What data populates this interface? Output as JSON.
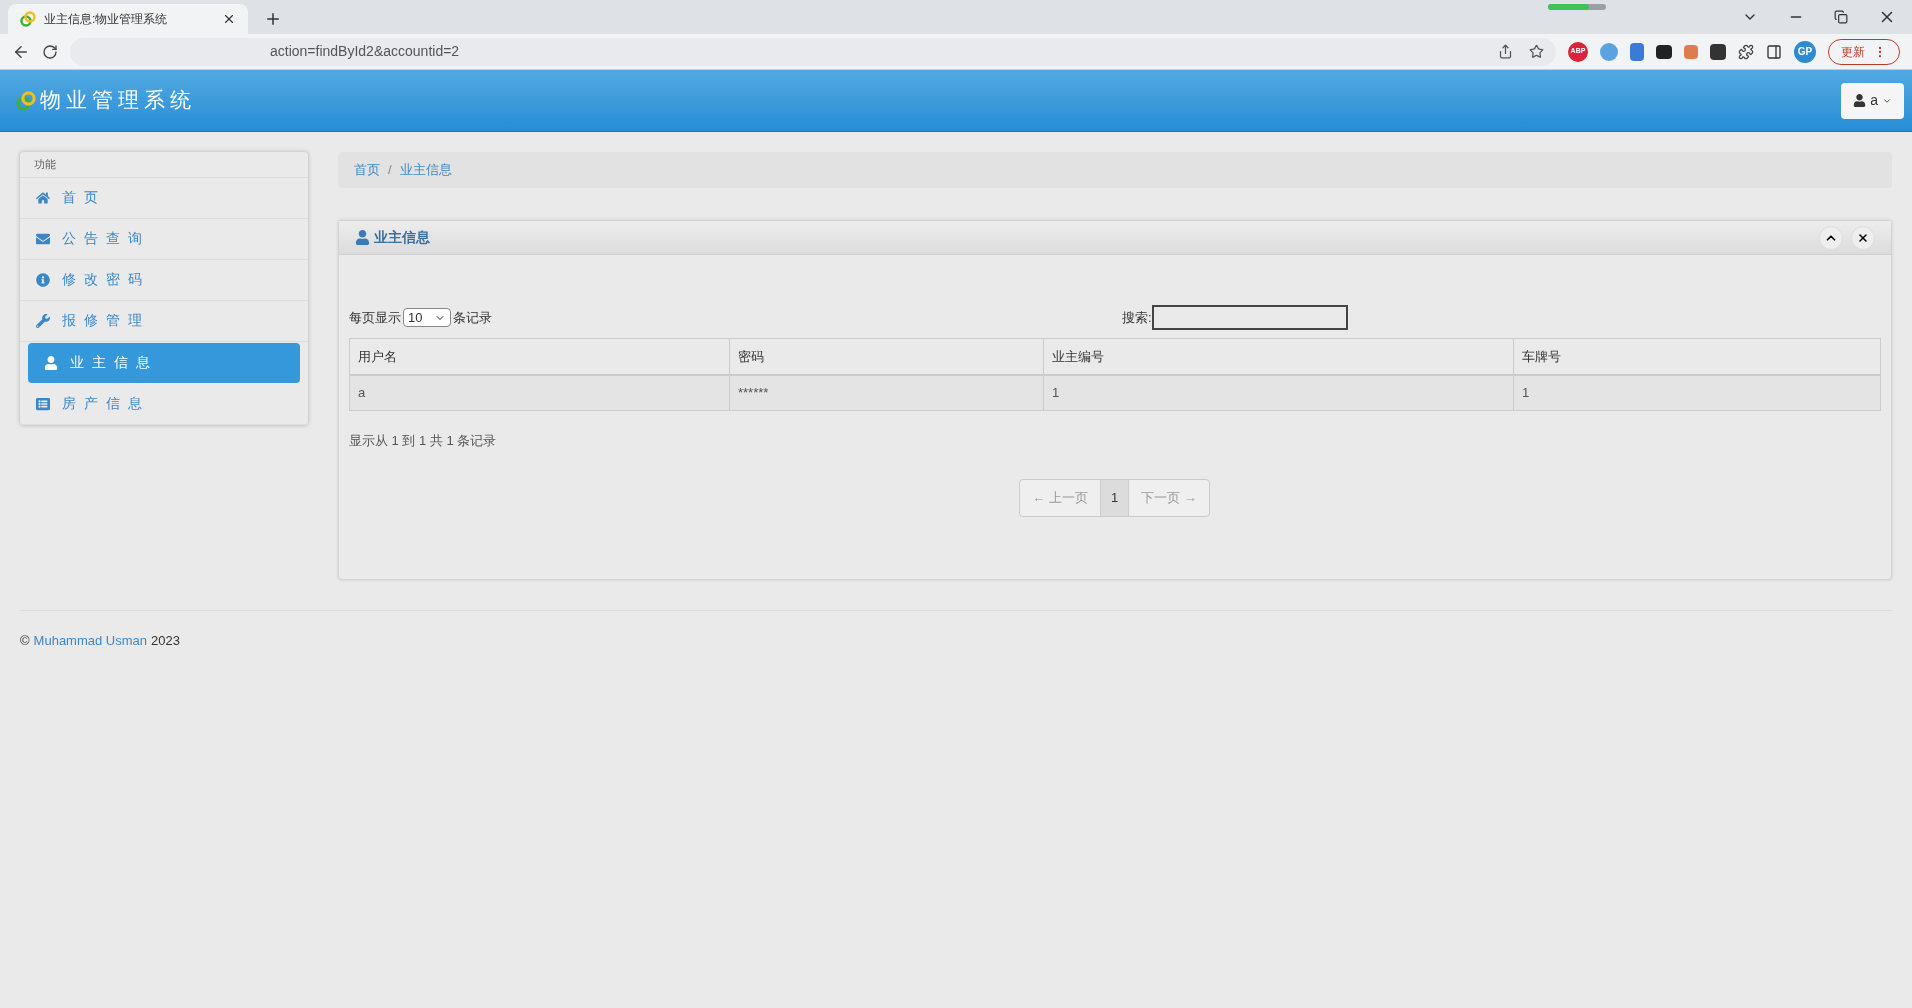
{
  "browser": {
    "tab": {
      "title": "业主信息:物业管理系统"
    },
    "url": "action=findById2&accountid=2",
    "extensions": [
      {
        "label": "ABP"
      },
      {
        "label": "GP"
      }
    ],
    "update_button": "更新"
  },
  "header": {
    "brand": "物业管理系统",
    "user_menu": "a"
  },
  "sidebar": {
    "heading": "功能",
    "items": [
      {
        "label": "首 页",
        "selected": false
      },
      {
        "label": "公 告 查 询",
        "selected": false
      },
      {
        "label": "修 改 密 码",
        "selected": false
      },
      {
        "label": "报 修 管 理",
        "selected": false
      },
      {
        "label": "业 主 信 息",
        "selected": true
      },
      {
        "label": "房 产 信 息",
        "selected": false
      }
    ]
  },
  "breadcrumb": {
    "separator": "/",
    "items": [
      "首页",
      "业主信息"
    ]
  },
  "tab_progress": {
    "level": 0.7
  },
  "panel": {
    "title": "业主信息",
    "length_control": {
      "prefix": "每页显示",
      "value": "10",
      "suffix": "条记录"
    },
    "search": {
      "label": "搜索:"
    },
    "table": {
      "columns": [
        "用户名",
        "密码",
        "业主编号",
        "车牌号"
      ],
      "rows": [
        [
          "a",
          "******",
          "1",
          "1"
        ]
      ]
    },
    "info": "显示从 1 到 1 共 1 条记录",
    "pagination": [
      {
        "label": "← 上一页",
        "kind": "nav",
        "disabled": true,
        "selected": false
      },
      {
        "label": "1",
        "kind": "page",
        "disabled": false,
        "selected": true
      },
      {
        "label": "下一页 →",
        "kind": "nav",
        "disabled": true,
        "selected": false
      }
    ]
  },
  "footer": {
    "symbol": "©",
    "author": "Muhammad Usman",
    "year": "2023"
  }
}
